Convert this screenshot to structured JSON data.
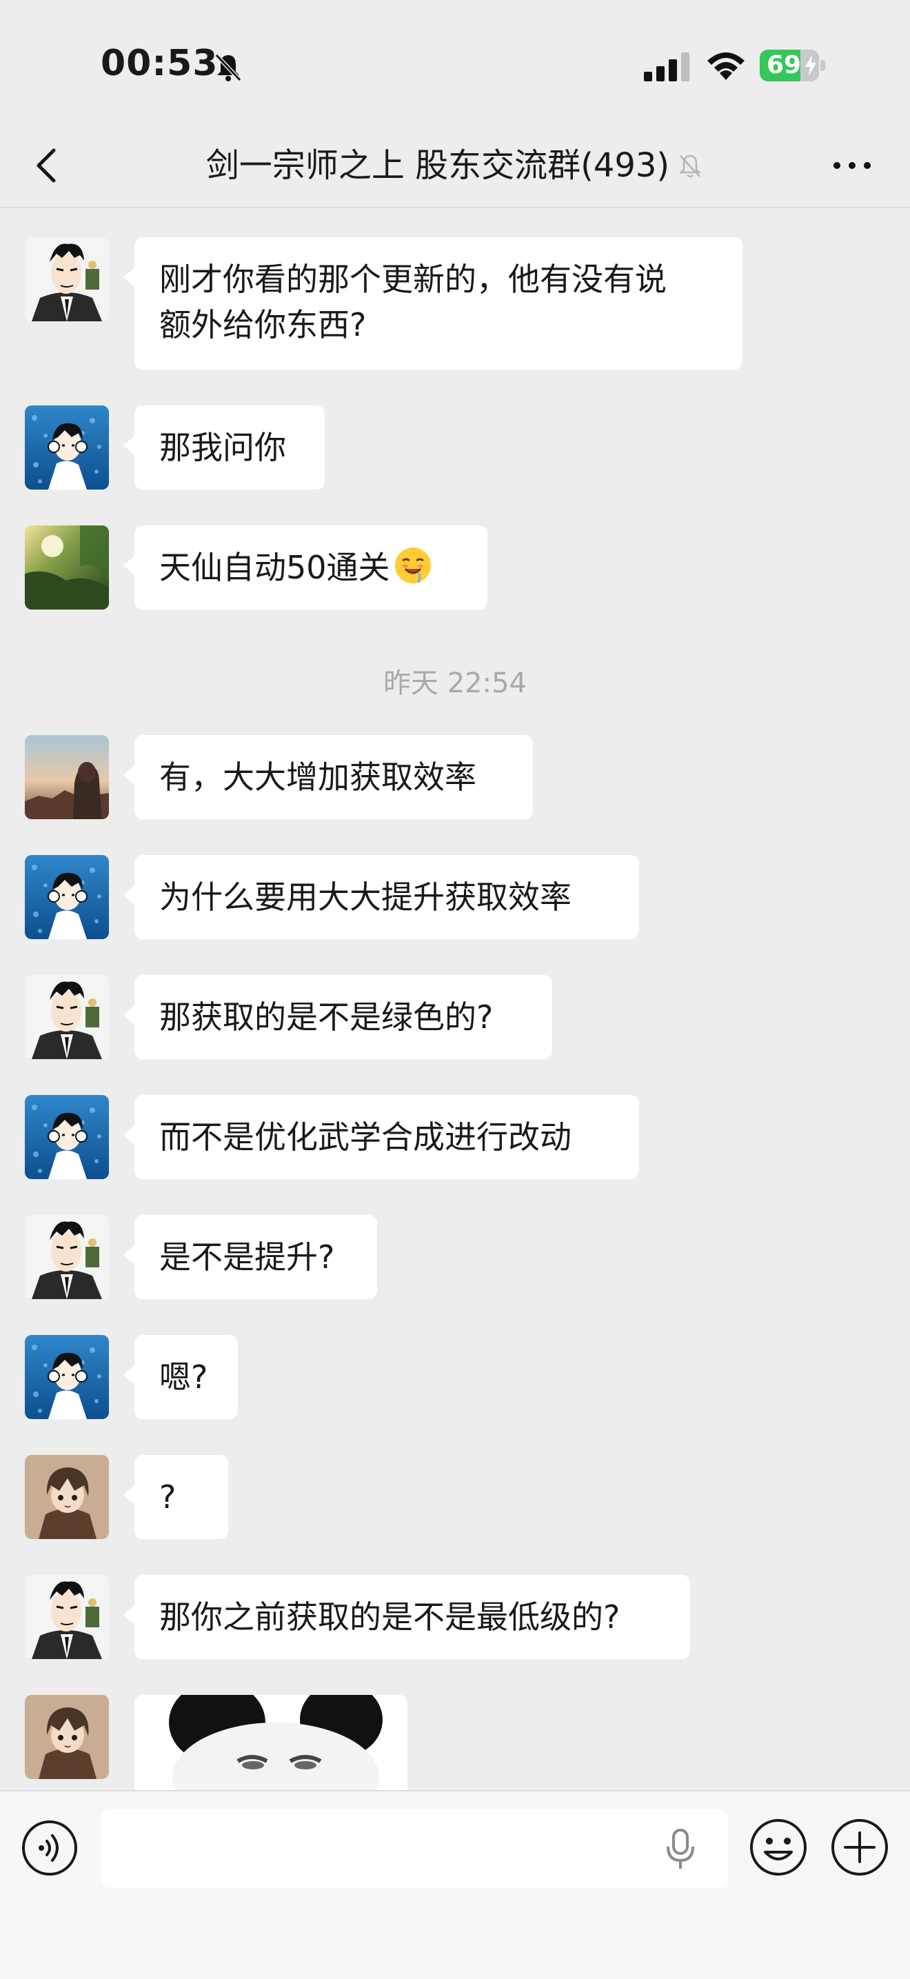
{
  "status_bar": {
    "time": "00:53",
    "battery": "69",
    "battery_level": 0.69,
    "icons": [
      "bell-off-icon",
      "signal-icon",
      "wifi-icon",
      "battery-charging-icon"
    ]
  },
  "nav": {
    "title": "剑一宗师之上 股东交流群(493)",
    "icons": [
      "chevron-left-icon",
      "mute-bell-icon",
      "more-dots-icon"
    ]
  },
  "messages": [
    {
      "text": "刚才你看的那个更新的，他有没有说\n额外给你东西?",
      "avatar": "avatar-suit-man"
    },
    {
      "text": "那我问你",
      "avatar": "avatar-headphones-boy"
    },
    {
      "text": "天仙自动50通关",
      "avatar": "avatar-forest-light",
      "emoji": "drooling-face-emoji"
    },
    {
      "text": "有，大大增加获取效率",
      "avatar": "avatar-girl-sunset"
    },
    {
      "text": "为什么要用大大提升获取效率",
      "avatar": "avatar-headphones-boy"
    },
    {
      "text": "那获取的是不是绿色的?",
      "avatar": "avatar-suit-man"
    },
    {
      "text": "而不是优化武学合成进行改动",
      "avatar": "avatar-headphones-boy"
    },
    {
      "text": "是不是提升?",
      "avatar": "avatar-suit-man"
    },
    {
      "text": "嗯?",
      "avatar": "avatar-headphones-boy"
    },
    {
      "text": "?",
      "avatar": "avatar-anime-girl"
    },
    {
      "text": "那你之前获取的是不是最低级的?",
      "avatar": "avatar-suit-man"
    },
    {
      "text": "",
      "avatar": "avatar-anime-girl",
      "sticker": "panda-meme-sticker"
    }
  ],
  "timestamp": "昨天 22:54",
  "input_bar": {
    "placeholder": "",
    "icons": [
      "voice-icon",
      "microphone-icon",
      "emoji-icon",
      "plus-icon"
    ]
  },
  "colors": {
    "background": "#ededed",
    "bubble": "#ffffff",
    "battery": "#34c759",
    "timestamp": "#a9a9a9"
  }
}
